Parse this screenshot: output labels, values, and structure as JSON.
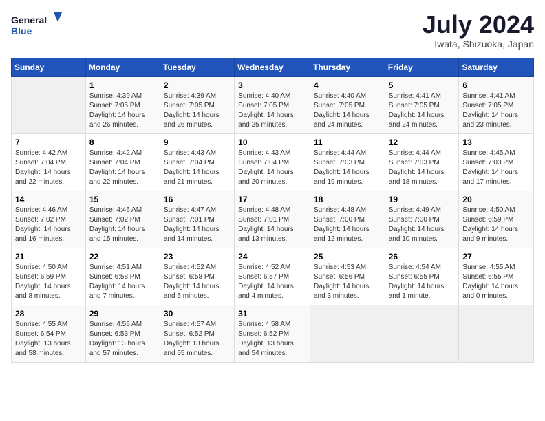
{
  "header": {
    "logo_line1": "General",
    "logo_line2": "Blue",
    "month_title": "July 2024",
    "location": "Iwata, Shizuoka, Japan"
  },
  "days_of_week": [
    "Sunday",
    "Monday",
    "Tuesday",
    "Wednesday",
    "Thursday",
    "Friday",
    "Saturday"
  ],
  "weeks": [
    [
      {
        "day": "",
        "sunrise": "",
        "sunset": "",
        "daylight": ""
      },
      {
        "day": "1",
        "sunrise": "Sunrise: 4:39 AM",
        "sunset": "Sunset: 7:05 PM",
        "daylight": "Daylight: 14 hours and 26 minutes."
      },
      {
        "day": "2",
        "sunrise": "Sunrise: 4:39 AM",
        "sunset": "Sunset: 7:05 PM",
        "daylight": "Daylight: 14 hours and 26 minutes."
      },
      {
        "day": "3",
        "sunrise": "Sunrise: 4:40 AM",
        "sunset": "Sunset: 7:05 PM",
        "daylight": "Daylight: 14 hours and 25 minutes."
      },
      {
        "day": "4",
        "sunrise": "Sunrise: 4:40 AM",
        "sunset": "Sunset: 7:05 PM",
        "daylight": "Daylight: 14 hours and 24 minutes."
      },
      {
        "day": "5",
        "sunrise": "Sunrise: 4:41 AM",
        "sunset": "Sunset: 7:05 PM",
        "daylight": "Daylight: 14 hours and 24 minutes."
      },
      {
        "day": "6",
        "sunrise": "Sunrise: 4:41 AM",
        "sunset": "Sunset: 7:05 PM",
        "daylight": "Daylight: 14 hours and 23 minutes."
      }
    ],
    [
      {
        "day": "7",
        "sunrise": "Sunrise: 4:42 AM",
        "sunset": "Sunset: 7:04 PM",
        "daylight": "Daylight: 14 hours and 22 minutes."
      },
      {
        "day": "8",
        "sunrise": "Sunrise: 4:42 AM",
        "sunset": "Sunset: 7:04 PM",
        "daylight": "Daylight: 14 hours and 22 minutes."
      },
      {
        "day": "9",
        "sunrise": "Sunrise: 4:43 AM",
        "sunset": "Sunset: 7:04 PM",
        "daylight": "Daylight: 14 hours and 21 minutes."
      },
      {
        "day": "10",
        "sunrise": "Sunrise: 4:43 AM",
        "sunset": "Sunset: 7:04 PM",
        "daylight": "Daylight: 14 hours and 20 minutes."
      },
      {
        "day": "11",
        "sunrise": "Sunrise: 4:44 AM",
        "sunset": "Sunset: 7:03 PM",
        "daylight": "Daylight: 14 hours and 19 minutes."
      },
      {
        "day": "12",
        "sunrise": "Sunrise: 4:44 AM",
        "sunset": "Sunset: 7:03 PM",
        "daylight": "Daylight: 14 hours and 18 minutes."
      },
      {
        "day": "13",
        "sunrise": "Sunrise: 4:45 AM",
        "sunset": "Sunset: 7:03 PM",
        "daylight": "Daylight: 14 hours and 17 minutes."
      }
    ],
    [
      {
        "day": "14",
        "sunrise": "Sunrise: 4:46 AM",
        "sunset": "Sunset: 7:02 PM",
        "daylight": "Daylight: 14 hours and 16 minutes."
      },
      {
        "day": "15",
        "sunrise": "Sunrise: 4:46 AM",
        "sunset": "Sunset: 7:02 PM",
        "daylight": "Daylight: 14 hours and 15 minutes."
      },
      {
        "day": "16",
        "sunrise": "Sunrise: 4:47 AM",
        "sunset": "Sunset: 7:01 PM",
        "daylight": "Daylight: 14 hours and 14 minutes."
      },
      {
        "day": "17",
        "sunrise": "Sunrise: 4:48 AM",
        "sunset": "Sunset: 7:01 PM",
        "daylight": "Daylight: 14 hours and 13 minutes."
      },
      {
        "day": "18",
        "sunrise": "Sunrise: 4:48 AM",
        "sunset": "Sunset: 7:00 PM",
        "daylight": "Daylight: 14 hours and 12 minutes."
      },
      {
        "day": "19",
        "sunrise": "Sunrise: 4:49 AM",
        "sunset": "Sunset: 7:00 PM",
        "daylight": "Daylight: 14 hours and 10 minutes."
      },
      {
        "day": "20",
        "sunrise": "Sunrise: 4:50 AM",
        "sunset": "Sunset: 6:59 PM",
        "daylight": "Daylight: 14 hours and 9 minutes."
      }
    ],
    [
      {
        "day": "21",
        "sunrise": "Sunrise: 4:50 AM",
        "sunset": "Sunset: 6:59 PM",
        "daylight": "Daylight: 14 hours and 8 minutes."
      },
      {
        "day": "22",
        "sunrise": "Sunrise: 4:51 AM",
        "sunset": "Sunset: 6:58 PM",
        "daylight": "Daylight: 14 hours and 7 minutes."
      },
      {
        "day": "23",
        "sunrise": "Sunrise: 4:52 AM",
        "sunset": "Sunset: 6:58 PM",
        "daylight": "Daylight: 14 hours and 5 minutes."
      },
      {
        "day": "24",
        "sunrise": "Sunrise: 4:52 AM",
        "sunset": "Sunset: 6:57 PM",
        "daylight": "Daylight: 14 hours and 4 minutes."
      },
      {
        "day": "25",
        "sunrise": "Sunrise: 4:53 AM",
        "sunset": "Sunset: 6:56 PM",
        "daylight": "Daylight: 14 hours and 3 minutes."
      },
      {
        "day": "26",
        "sunrise": "Sunrise: 4:54 AM",
        "sunset": "Sunset: 6:55 PM",
        "daylight": "Daylight: 14 hours and 1 minute."
      },
      {
        "day": "27",
        "sunrise": "Sunrise: 4:55 AM",
        "sunset": "Sunset: 6:55 PM",
        "daylight": "Daylight: 14 hours and 0 minutes."
      }
    ],
    [
      {
        "day": "28",
        "sunrise": "Sunrise: 4:55 AM",
        "sunset": "Sunset: 6:54 PM",
        "daylight": "Daylight: 13 hours and 58 minutes."
      },
      {
        "day": "29",
        "sunrise": "Sunrise: 4:56 AM",
        "sunset": "Sunset: 6:53 PM",
        "daylight": "Daylight: 13 hours and 57 minutes."
      },
      {
        "day": "30",
        "sunrise": "Sunrise: 4:57 AM",
        "sunset": "Sunset: 6:52 PM",
        "daylight": "Daylight: 13 hours and 55 minutes."
      },
      {
        "day": "31",
        "sunrise": "Sunrise: 4:58 AM",
        "sunset": "Sunset: 6:52 PM",
        "daylight": "Daylight: 13 hours and 54 minutes."
      },
      {
        "day": "",
        "sunrise": "",
        "sunset": "",
        "daylight": ""
      },
      {
        "day": "",
        "sunrise": "",
        "sunset": "",
        "daylight": ""
      },
      {
        "day": "",
        "sunrise": "",
        "sunset": "",
        "daylight": ""
      }
    ]
  ]
}
